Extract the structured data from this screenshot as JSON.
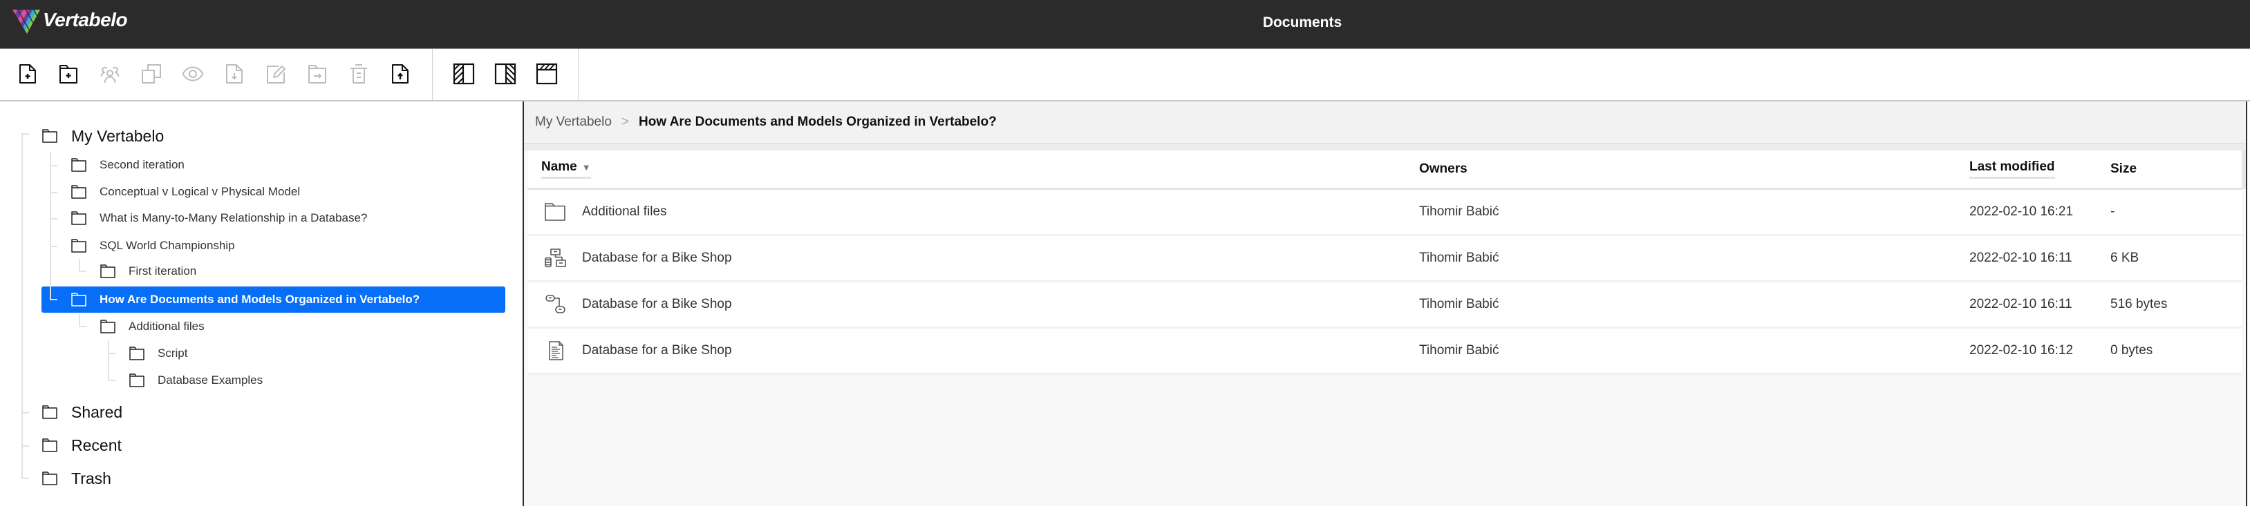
{
  "app": {
    "brand": "Vertabelo",
    "title": "Documents"
  },
  "colors": {
    "header_bg": "#2b2b2b",
    "accent": "#066ef7",
    "disabled_icon": "#bdbdbd"
  },
  "toolbar": {
    "actions": [
      {
        "id": "new-document",
        "icon": "new-document-icon",
        "enabled": true
      },
      {
        "id": "new-folder",
        "icon": "new-folder-icon",
        "enabled": true
      },
      {
        "id": "share",
        "icon": "share-icon",
        "enabled": false
      },
      {
        "id": "duplicate",
        "icon": "copy-icon",
        "enabled": false
      },
      {
        "id": "view",
        "icon": "eye-icon",
        "enabled": false
      },
      {
        "id": "download",
        "icon": "download-icon",
        "enabled": false
      },
      {
        "id": "rename",
        "icon": "edit-icon",
        "enabled": false
      },
      {
        "id": "move",
        "icon": "move-to-folder-icon",
        "enabled": false
      },
      {
        "id": "delete",
        "icon": "trash-icon",
        "enabled": false
      },
      {
        "id": "upload",
        "icon": "upload-icon",
        "enabled": true
      }
    ],
    "layouts": [
      {
        "id": "layout-left",
        "icon": "layout-left-panel-icon"
      },
      {
        "id": "layout-right",
        "icon": "layout-right-panel-icon"
      },
      {
        "id": "layout-top",
        "icon": "layout-top-panel-icon"
      }
    ]
  },
  "tree": {
    "items": [
      {
        "label": "My Vertabelo",
        "level": 0
      },
      {
        "label": "Second iteration",
        "level": 1
      },
      {
        "label": "Conceptual v Logical v Physical Model",
        "level": 1
      },
      {
        "label": "What is Many-to-Many Relationship in a Database?",
        "level": 1
      },
      {
        "label": "SQL World Championship",
        "level": 1
      },
      {
        "label": "First iteration",
        "level": 2
      },
      {
        "label": "How Are Documents and Models Organized in Vertabelo?",
        "level": 1,
        "selected": true
      },
      {
        "label": "Additional files",
        "level": 2
      },
      {
        "label": "Script",
        "level": 3
      },
      {
        "label": "Database Examples",
        "level": 3
      },
      {
        "label": "Shared",
        "level": 0
      },
      {
        "label": "Recent",
        "level": 0
      },
      {
        "label": "Trash",
        "level": 0
      }
    ]
  },
  "breadcrumb": {
    "items": [
      "My Vertabelo",
      "How Are Documents and Models Organized in Vertabelo?"
    ],
    "separator": ">"
  },
  "table": {
    "columns": [
      {
        "label": "Name",
        "sorted": true
      },
      {
        "label": "Owners"
      },
      {
        "label": "Last modified"
      },
      {
        "label": "Size"
      }
    ],
    "sort_indicator": "▼",
    "rows": [
      {
        "type": "folder",
        "name": "Additional files",
        "owner": "Tihomir Babić",
        "modified": "2022-02-10 16:21",
        "size": "-"
      },
      {
        "type": "physical-model",
        "name": "Database for a Bike Shop",
        "owner": "Tihomir Babić",
        "modified": "2022-02-10 16:11",
        "size": "6 KB"
      },
      {
        "type": "logical-model",
        "name": "Database for a Bike Shop",
        "owner": "Tihomir Babić",
        "modified": "2022-02-10 16:11",
        "size": "516 bytes"
      },
      {
        "type": "document",
        "name": "Database for a Bike Shop",
        "owner": "Tihomir Babić",
        "modified": "2022-02-10 16:12",
        "size": "0 bytes"
      }
    ]
  }
}
